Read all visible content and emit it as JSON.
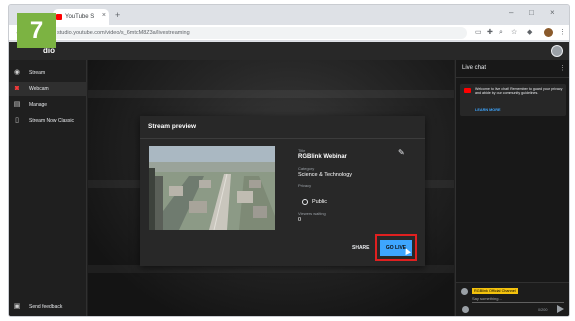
{
  "step_badge": "7",
  "browser": {
    "tab_title": "YouTube S",
    "tab_close": "×",
    "new_tab": "+",
    "window_controls": [
      "–",
      "□",
      "×"
    ],
    "url": "studio.youtube.com/video/s_6mtcM8Z3a/livestreaming",
    "toolbar_icons": [
      "cast-icon",
      "extensions-icon",
      "search-icon",
      "star-icon",
      "profile-icon",
      "menu-icon"
    ]
  },
  "studio": {
    "logo_text": "dio"
  },
  "sidebar": {
    "items": [
      {
        "label": "Stream",
        "icon": "stream-icon",
        "active": false
      },
      {
        "label": "Webcam",
        "icon": "webcam-icon",
        "active": true
      },
      {
        "label": "Manage",
        "icon": "calendar-icon",
        "active": false
      },
      {
        "label": "Stream Now Classic",
        "icon": "phone-icon",
        "active": false
      }
    ],
    "feedback_label": "Send feedback"
  },
  "dialog": {
    "title": "Stream preview",
    "title_label": "Title",
    "title_value": "RGBlink Webinar",
    "category_label": "Category",
    "category_value": "Science & Technology",
    "privacy_label": "Privacy",
    "privacy_value": "Public",
    "viewers_label": "Viewers waiting",
    "viewers_value": "0",
    "share_label": "SHARE",
    "golive_label": "GO LIVE"
  },
  "chat": {
    "title": "Live chat",
    "more": "⋮",
    "welcome_text": "Welcome to live chat! Remember to guard your privacy and abide by our community guidelines.",
    "learn_more": "LEARN MORE",
    "author_name": "RGBlink Official Channel",
    "input_placeholder": "Say something...",
    "char_counter": "0/200"
  },
  "colors": {
    "badge": "#7cb342",
    "accent": "#3ea6ff",
    "highlight": "#e02020",
    "brand": "#ff0000"
  }
}
